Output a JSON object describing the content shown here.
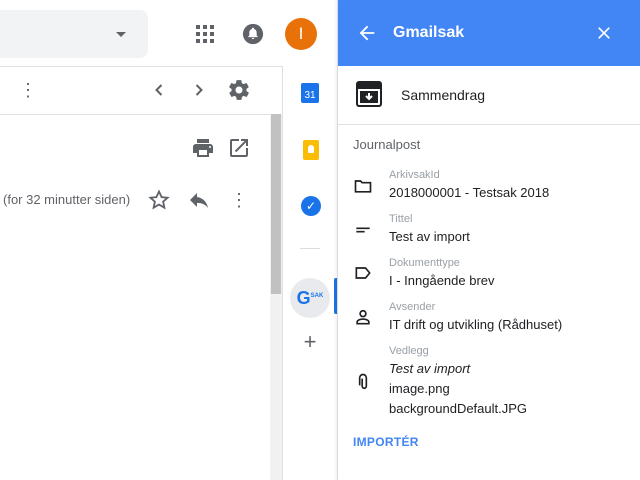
{
  "header": {
    "avatar_letter": "I"
  },
  "message": {
    "time_text": "(for 32 minutter siden)"
  },
  "rail": {
    "calendar_day": "31"
  },
  "panel": {
    "title": "Gmailsak",
    "summary_label": "Sammendrag",
    "section_title": "Journalpost",
    "fields": [
      {
        "label": "ArkivsakId",
        "value": "2018000001 - Testsak 2018",
        "icon": "folder-icon"
      },
      {
        "label": "Tittel",
        "value": "Test av import",
        "icon": "short-text-icon"
      },
      {
        "label": "Dokumenttype",
        "value": "I - Inngående brev",
        "icon": "label-icon"
      },
      {
        "label": "Avsender",
        "value": "IT drift og utvikling  (Rådhuset)",
        "icon": "person-icon"
      }
    ],
    "attachments": {
      "label": "Vedlegg",
      "items": [
        "Test av import",
        "image.png",
        "backgroundDefault.JPG"
      ],
      "icon": "attachment-icon"
    },
    "import_button": "IMPORTÉR"
  },
  "colors": {
    "panel_header": "#4285f4",
    "avatar": "#e8710a",
    "accent": "#1a73e8"
  }
}
